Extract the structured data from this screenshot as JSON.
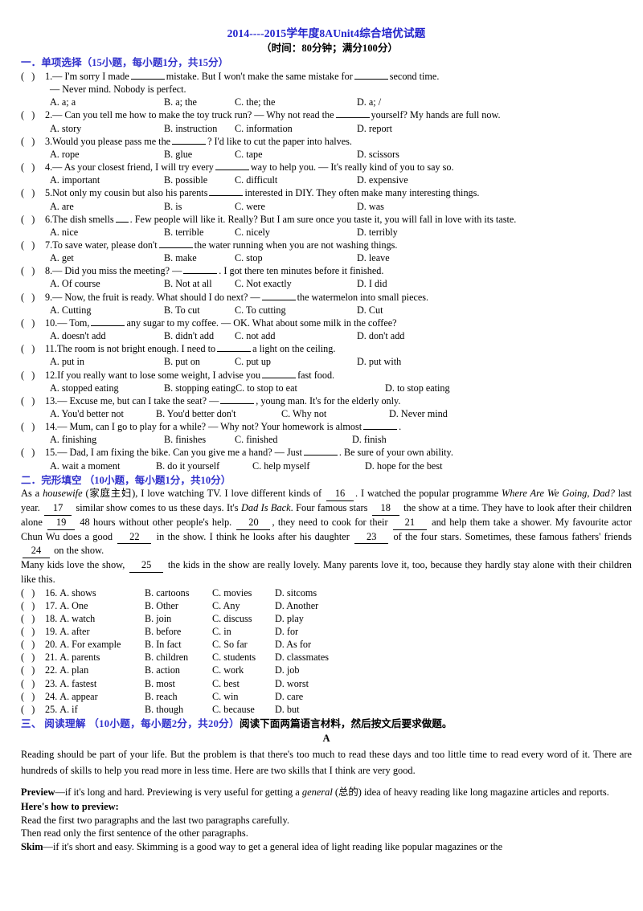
{
  "header": {
    "title": "2014----2015学年度8AUnit4综合培优试题",
    "subtitle": "（时间：80分钟；满分100分）",
    "title_color": "#2222cc"
  },
  "section1": {
    "heading_cn": "一．单项选择（15小题，每小题1分，共15分）",
    "questions": [
      {
        "num": "1.",
        "stem_a": "— I'm sorry I made",
        "stem_b": "mistake. But I won't make the same mistake for",
        "stem_c": "second time.",
        "stem_line2": "— Never mind. Nobody is perfect.",
        "a": "A. a; a",
        "b": "B. a; the",
        "c": "C. the; the",
        "d": "D. a; /"
      },
      {
        "num": "2.",
        "stem_a": "— Can you tell me how to make the toy truck run?      — Why not read the",
        "stem_b": "yourself? My hands are full now.",
        "a": "A. story",
        "b": "B. instruction",
        "c": "C. information",
        "d": "D. report"
      },
      {
        "num": "3.",
        "stem_a": "Would you please pass me the",
        "stem_b": "? I'd like to cut the paper into halves.",
        "a": "A. rope",
        "b": "B. glue",
        "c": "C. tape",
        "d": "D. scissors"
      },
      {
        "num": "4.",
        "stem_a": "— As your closest friend, I will try every",
        "stem_b": "way to help you.    — It's really kind of you to say so.",
        "a": "A. important",
        "b": "B. possible",
        "c": "C. difficult",
        "d": "D. expensive"
      },
      {
        "num": "5.",
        "stem_a": "Not only my cousin but also his parents",
        "stem_b": "interested in DIY. They often make many interesting things.",
        "a": "A. are",
        "b": "B. is",
        "c": "C. were",
        "d": "D. was"
      },
      {
        "num": "6.",
        "stem_a": "The dish smells",
        "stem_b": ". Few people will like it. Really? But I am sure once you taste it, you will fall in love with its taste.",
        "a": "A. nice",
        "b": "B. terrible",
        "c": "C. nicely",
        "d": "D. terribly"
      },
      {
        "num": "7.",
        "stem_a": "To save water, please don't",
        "stem_b": "the water running when you are not washing things.",
        "a": "A. get",
        "b": "B. make",
        "c": "C. stop",
        "d": "D. leave"
      },
      {
        "num": "8.",
        "stem_a": "— Did you miss the meeting?     —",
        "stem_b": ". I got there ten minutes before it finished.",
        "a": "A. Of course",
        "b": "B. Not at all",
        "c": "C. Not exactly",
        "d": "D. I did"
      },
      {
        "num": "9.",
        "stem_a": "— Now, the fruit is ready. What should I do next?     —",
        "stem_b": "the watermelon into small pieces.",
        "a": "A. Cutting",
        "b": "B. To cut",
        "c": "C. To cutting",
        "d": "D. Cut"
      },
      {
        "num": "10.",
        "stem_a": "— Tom,",
        "stem_b": "any sugar to my coffee.           — OK. What about some milk in the coffee?",
        "a": "A. doesn't add",
        "b": "B. didn't add",
        "c": "C. not add",
        "d": "D. don't add"
      },
      {
        "num": "11.",
        "stem_a": "The room is not bright enough. I need to",
        "stem_b": "a light on the ceiling.",
        "a": "A. put in",
        "b": "B. put on",
        "c": "C. put up",
        "d": "D. put with"
      },
      {
        "num": "12.",
        "stem_a": "If you really want to lose some weight, I advise you",
        "stem_b": "fast food.",
        "a": "A. stopped eating",
        "b": "B. stopping eating",
        "c": "C. to stop to eat",
        "d": "D. to stop eating"
      },
      {
        "num": "13.",
        "stem_a": "— Excuse me, but can I take the seat?      —",
        "stem_b": ", young man. It's for the elderly only.",
        "a": "A. You'd better not",
        "b": "B. You'd better don't",
        "c": "C. Why not",
        "d": "D. Never mind"
      },
      {
        "num": "14.",
        "stem_a": "— Mum, can I go to play for a while?      — Why not? Your homework is almost",
        "stem_b": ".",
        "a": "A. finishing",
        "b": "B. finishes",
        "c": "C. finished",
        "d": "D. finish"
      },
      {
        "num": "15.",
        "stem_a": "— Dad, I am fixing the bike. Can you give me a hand?          — Just",
        "stem_b": ". Be sure of your own ability.",
        "a": "A. wait a moment",
        "b": "B. do it yourself",
        "c": "C. help myself",
        "d": "D. hope for the best"
      }
    ]
  },
  "section2": {
    "heading_cn": "二．完形填空 （10小题，每小题1分，共10分）",
    "passage": {
      "p1_a": "As a ",
      "p1_it1": "housewife",
      "p1_b": " (家庭主妇), I love watching TV. I love different kinds of ",
      "blank16": "16",
      "p1_c": ". I watched the popular programme ",
      "p1_it2": "Where Are We Going, Dad?",
      "p1_d": " last year. ",
      "blank17": "17",
      "p1_e": " similar show comes to us these days. It's ",
      "p1_it3": "Dad Is Back",
      "p1_f": ". Four famous stars ",
      "blank18": "18",
      "p1_g": " the show at a time. They have  to look after their children alone ",
      "blank19": "19",
      "p1_h": " 48 hours without other people's help. ",
      "blank20": "20",
      "p1_i": ", they need to cook for their ",
      "blank21": "21",
      "p1_j": " and help them take a shower. My favourite actor Chun Wu does a good ",
      "blank22": "22",
      "p1_k": " in the show. I think he looks after his daughter ",
      "blank23": "23",
      "p1_l": " of the four stars. Sometimes, these famous fathers' friends ",
      "blank24": "24",
      "p1_m": " on the show.",
      "p2_a": "Many kids love the show, ",
      "blank25": "25",
      "p2_b": " the kids in the show are really lovely. Many parents love it, too, because they hardly stay alone with their children like this."
    },
    "questions": [
      {
        "num": "16.",
        "a": "A. shows",
        "b": "B. cartoons",
        "c": "C. movies",
        "d": "D. sitcoms"
      },
      {
        "num": "17.",
        "a": "A. One",
        "b": "B. Other",
        "c": "C. Any",
        "d": "D. Another"
      },
      {
        "num": "18.",
        "a": "A. watch",
        "b": "B. join",
        "c": "C. discuss",
        "d": "D. play"
      },
      {
        "num": "19.",
        "a": "A. after",
        "b": "B. before",
        "c": "C. in",
        "d": "D. for"
      },
      {
        "num": "20.",
        "a": "A. For example",
        "b": "B. In fact",
        "c": "C. So far",
        "d": "D. As for"
      },
      {
        "num": "21.",
        "a": "A. parents",
        "b": "B. children",
        "c": "C. students",
        "d": "D. classmates"
      },
      {
        "num": "22.",
        "a": "A. plan",
        "b": "B. action",
        "c": "C. work",
        "d": "D. job"
      },
      {
        "num": "23.",
        "a": "A. fastest",
        "b": "B. most",
        "c": "C. best",
        "d": "D. worst"
      },
      {
        "num": "24.",
        "a": "A. appear",
        "b": "B. reach",
        "c": "C. win",
        "d": "D. care"
      },
      {
        "num": "25.",
        "a": "A. if",
        "b": "B. though",
        "c": "C. because",
        "d": "D. but"
      }
    ]
  },
  "section3": {
    "heading_cn": "三、 阅读理解 （10小题，每小题2分，共20分）",
    "heading_tail": "阅读下面两篇语言材料，然后按文后要求做题。",
    "passage_letter": "A",
    "para1": "Reading should be part of your life. But the problem is that there's too much to read these days and too little time to read every word of it. There are hundreds of skills to help you read more in less time. Here are two skills that I think are very good.",
    "preview_label": "Preview",
    "preview_a": "—if it's long and hard. Previewing is very useful for getting a ",
    "preview_it": "general",
    "preview_b": " (总的) idea of heavy reading like long magazine articles and reports.",
    "howto_label": "Here's how to preview:",
    "howto_line1": "Read the first two paragraphs and the last two paragraphs carefully.",
    "howto_line2": "Then read only the first sentence of the other paragraphs.",
    "skim_label": "Skim",
    "skim_text": "—if it's short and easy. Skimming is a good way to get a general idea of light reading like popular magazines or the"
  }
}
